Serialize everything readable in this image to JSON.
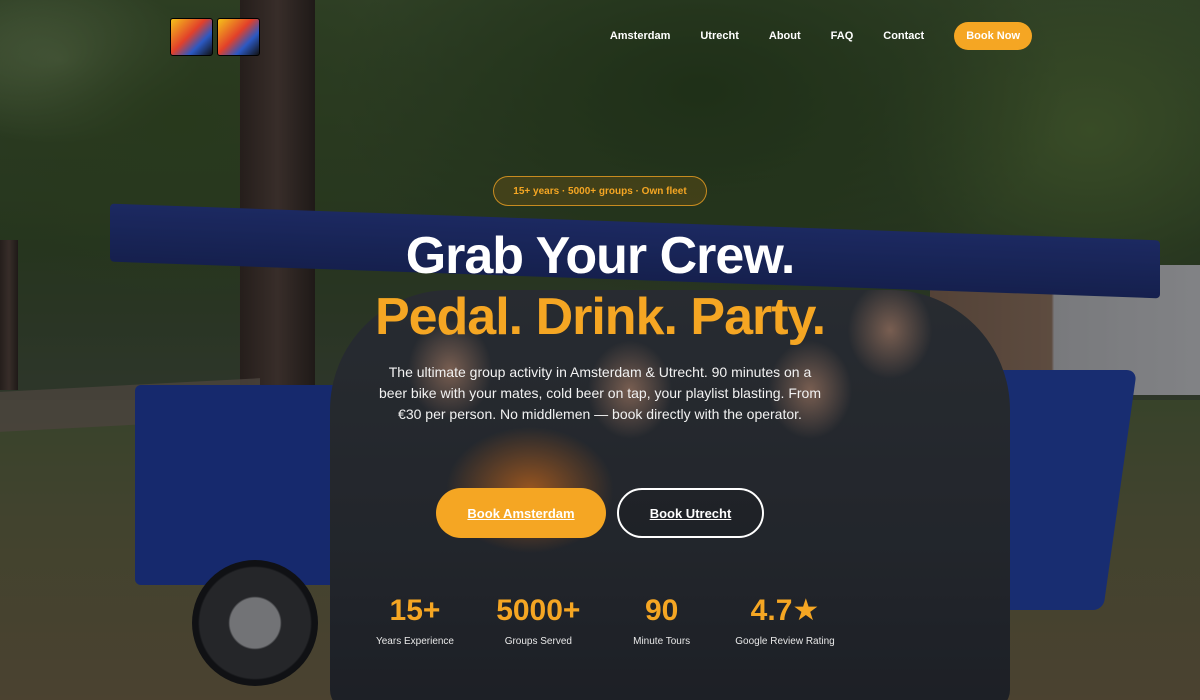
{
  "nav": {
    "items": [
      "Amsterdam",
      "Utrecht",
      "About",
      "FAQ",
      "Contact"
    ],
    "cta": "Book Now"
  },
  "hero": {
    "badge": "15+ years · 5000+ groups · Own fleet",
    "headline_line1": "Grab Your Crew.",
    "headline_line2": "Pedal. Drink. Party.",
    "description": "The ultimate group activity in Amsterdam & Utrecht. 90 minutes on a beer bike with your mates, cold beer on tap, your playlist blasting. From €30 per person. No middlemen — book directly with the operator.",
    "primary_button": "Book Amsterdam",
    "secondary_button": "Book Utrecht"
  },
  "stats": [
    {
      "value": "15+",
      "label": "Years Experience"
    },
    {
      "value": "5000+",
      "label": "Groups Served"
    },
    {
      "value": "90",
      "label": "Minute Tours"
    },
    {
      "value": "4.7★",
      "label": "Google Review Rating"
    }
  ],
  "colors": {
    "accent": "#f5a623",
    "text": "#ffffff"
  }
}
